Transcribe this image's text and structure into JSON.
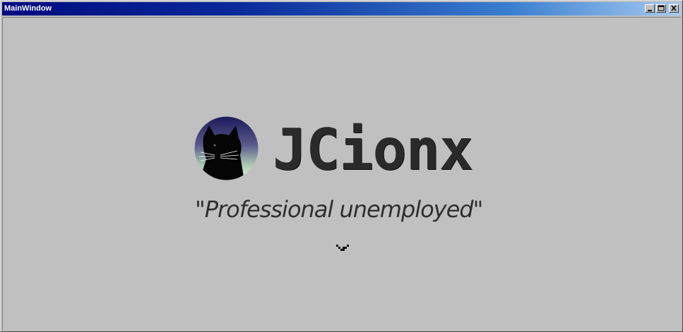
{
  "window": {
    "title": "MainWindow",
    "controls": {
      "minimize": "minimize-icon",
      "maximize": "maximize-icon",
      "close": "close-icon"
    }
  },
  "content": {
    "brand_name": "JCionx",
    "tagline": "\"Professional unemployed\"",
    "avatar_icon": "black-cat-avatar",
    "scroll_indicator_icon": "chevron-down-icon"
  },
  "colors": {
    "background": "#c0c0c0",
    "title_bar_start": "#000a7e",
    "title_bar_end": "#a6caf0",
    "brand_text": "#2a2a2a"
  }
}
